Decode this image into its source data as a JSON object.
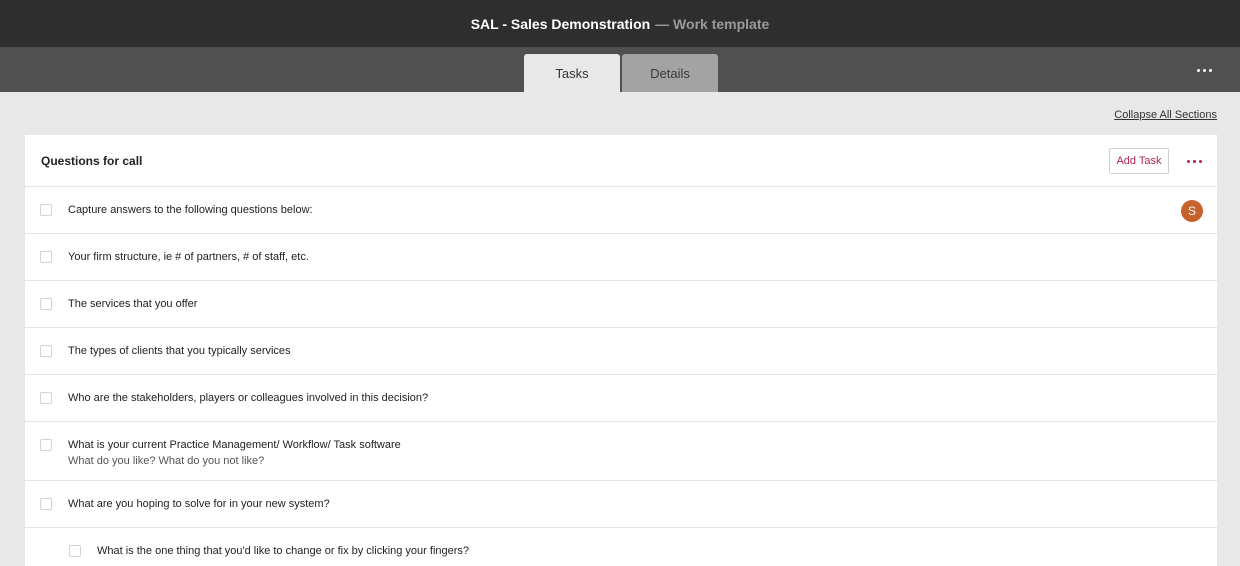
{
  "header": {
    "title": "SAL - Sales Demonstration",
    "subtitle": "— Work template"
  },
  "tabs": [
    {
      "label": "Tasks",
      "active": true
    },
    {
      "label": "Details",
      "active": false
    }
  ],
  "top_more_icon": "more-horizontal-icon",
  "collapse_label": "Collapse All Sections",
  "section": {
    "title": "Questions for call",
    "add_task_label": "Add Task",
    "more_icon": "more-horizontal-icon",
    "accent_color": "#b0245a",
    "tasks": [
      {
        "text": "Capture answers to the following questions below:",
        "assignee_initial": "S",
        "assignee_color": "#c8622c"
      },
      {
        "text": "Your firm structure, ie # of partners, # of staff, etc."
      },
      {
        "text": "The services that you offer"
      },
      {
        "text": "The types of clients that you typically services"
      },
      {
        "text": "Who are the stakeholders, players or colleagues involved in this decision?"
      },
      {
        "text": "What is your current Practice Management/ Workflow/ Task software",
        "subtext": "What do you like? What do you not like?"
      },
      {
        "text": "What are you hoping to solve for in your new system?"
      },
      {
        "text": "What is the one thing that you'd like to change or fix by clicking your fingers?",
        "indent": true
      }
    ]
  }
}
